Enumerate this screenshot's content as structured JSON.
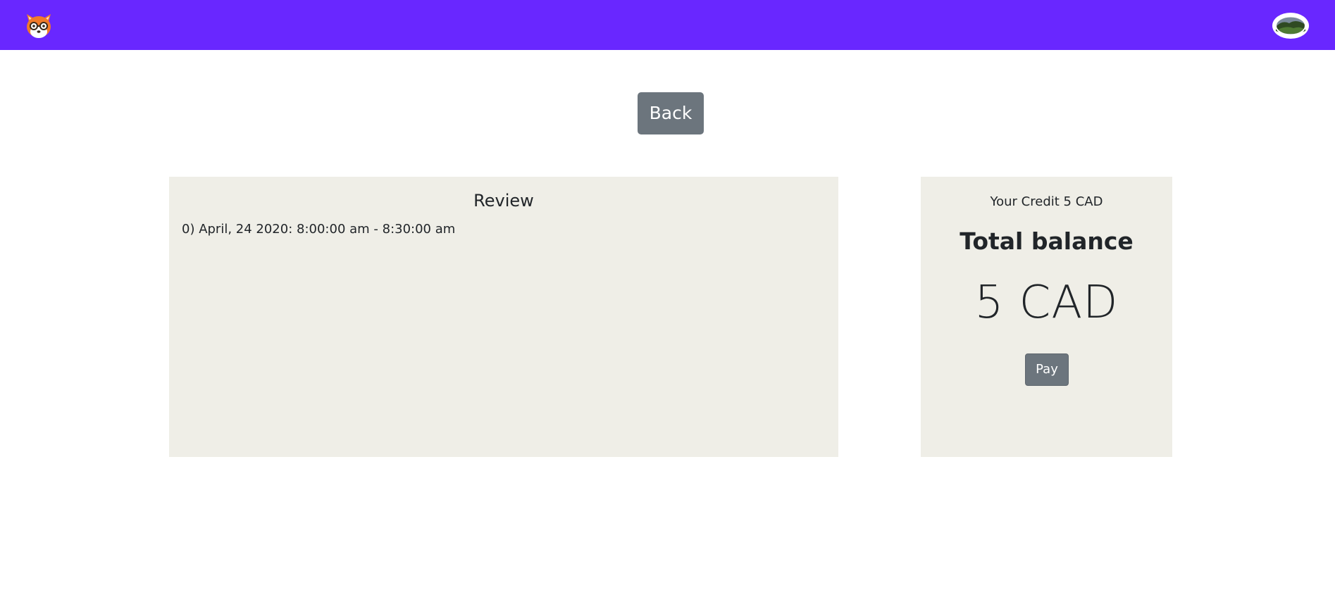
{
  "navbar": {
    "background": "#6927ff",
    "logo_icon": "fox-glasses-logo-icon",
    "avatar_icon": "profile-avatar-landscape-icon"
  },
  "back_button": {
    "label": "Back"
  },
  "review": {
    "title": "Review",
    "items": [
      "0) April, 24 2020: 8:00:00 am - 8:30:00 am"
    ]
  },
  "balance": {
    "credit_text": "Your Credit 5 CAD",
    "heading": "Total balance",
    "amount": "5 CAD",
    "pay_label": "Pay"
  },
  "colors": {
    "brand": "#6927ff",
    "panel_bg": "#efeee7",
    "button_secondary": "#6c757d"
  }
}
